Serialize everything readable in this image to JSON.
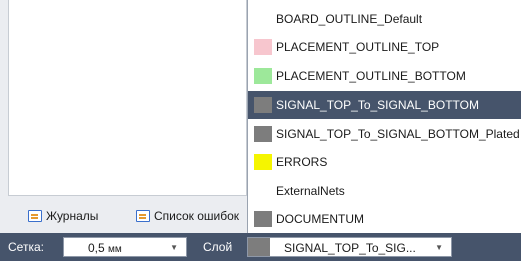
{
  "bottom_tabs": [
    {
      "label": "Журналы",
      "icon": "log-window-icon"
    },
    {
      "label": "Список ошибок",
      "icon": "error-list-icon"
    }
  ],
  "statusbar": {
    "grid_label": "Сетка:",
    "grid_value": "0,5",
    "grid_unit": "мм",
    "layer_label": "Слой",
    "layer_value": "SIGNAL_TOP_To_SIG...",
    "layer_color": "#7d7d7d",
    "background": "#46546b"
  },
  "layer_dropdown": {
    "items": [
      {
        "label": "BOARD_OUTLINE_Default",
        "color": "#ffffff",
        "selected": false
      },
      {
        "label": "PLACEMENT_OUTLINE_TOP",
        "color": "#f7c6ce",
        "selected": false
      },
      {
        "label": "PLACEMENT_OUTLINE_BOTTOM",
        "color": "#9de89a",
        "selected": false
      },
      {
        "label": "SIGNAL_TOP_To_SIGNAL_BOTTOM",
        "color": "#7d7d7d",
        "selected": true
      },
      {
        "label": "SIGNAL_TOP_To_SIGNAL_BOTTOM_Plated",
        "color": "#7d7d7d",
        "selected": false
      },
      {
        "label": "ERRORS",
        "color": "#f5f500",
        "selected": false
      },
      {
        "label": "ExternalNets",
        "color": "#ffffff",
        "selected": false
      },
      {
        "label": "DOCUMENTUM",
        "color": "#7d7d7d",
        "selected": false
      }
    ]
  }
}
